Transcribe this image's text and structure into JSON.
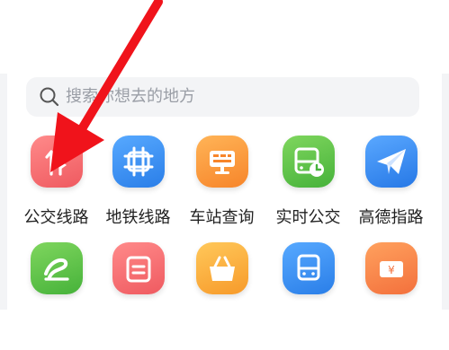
{
  "search": {
    "placeholder": "搜索你想去的地方"
  },
  "grid": {
    "row1": [
      {
        "label": "公交线路",
        "icon": "bus-route-icon",
        "color": "#f2676a"
      },
      {
        "label": "地铁线路",
        "icon": "metro-line-icon",
        "color": "#2e8df0"
      },
      {
        "label": "车站查询",
        "icon": "station-board-icon",
        "color": "#f99a2f"
      },
      {
        "label": "实时公交",
        "icon": "realtime-bus-icon",
        "color": "#5cc241"
      },
      {
        "label": "高德指路",
        "icon": "paper-plane-icon",
        "color": "#2f86ee"
      }
    ],
    "row2": [
      {
        "icon": "swirl-logo-icon",
        "color": "#5cc241"
      },
      {
        "icon": "card-icon",
        "color": "#f2676a"
      },
      {
        "icon": "basket-icon",
        "color": "#f99a2f"
      },
      {
        "icon": "bus-front-icon",
        "color": "#2e8df0"
      },
      {
        "icon": "yen-ticket-icon",
        "color": "#f97f4a"
      }
    ]
  },
  "annotation": {
    "arrow_color": "#f0131b"
  }
}
